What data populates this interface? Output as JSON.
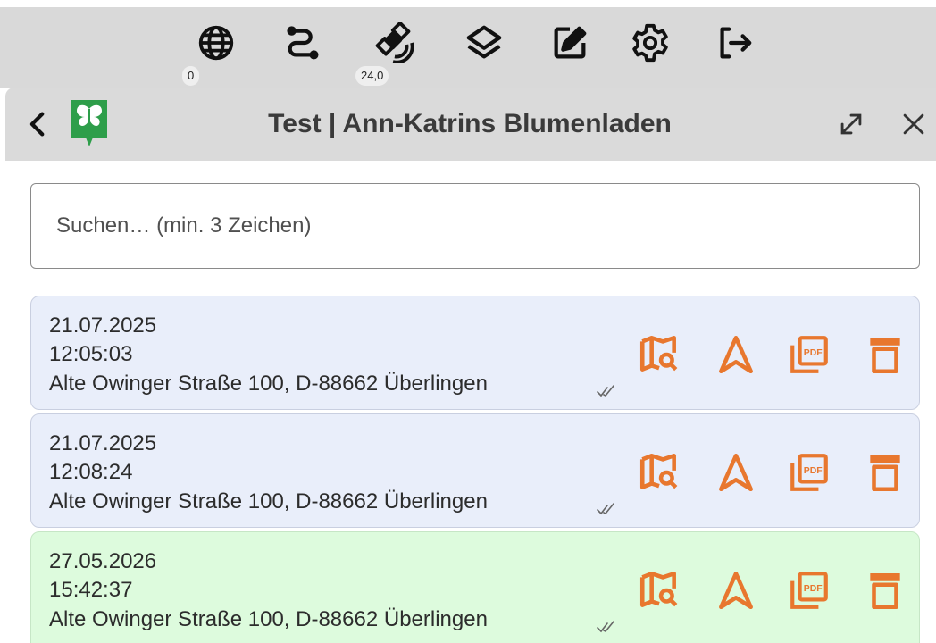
{
  "toolbar": {
    "items": [
      {
        "icon": "globe-icon",
        "badge": "0"
      },
      {
        "icon": "route-icon"
      },
      {
        "icon": "gps-satellite-icon",
        "badge": "24,0"
      },
      {
        "icon": "layers-icon"
      },
      {
        "icon": "edit-icon"
      },
      {
        "icon": "settings-gear-icon"
      },
      {
        "icon": "logout-icon"
      }
    ]
  },
  "panel": {
    "title": "Test | Ann-Katrins Blumenladen",
    "logo_icon": "butterfly-logo-icon"
  },
  "search": {
    "placeholder": "Suchen… (min. 3 Zeichen)",
    "value": ""
  },
  "entries": [
    {
      "date": "21.07.2025",
      "time": "12:05:03",
      "address": "Alte Owinger Straße 100, D-88662 Überlingen",
      "status": "synced"
    },
    {
      "date": "21.07.2025",
      "time": "12:08:24",
      "address": "Alte Owinger Straße 100, D-88662 Überlingen",
      "status": "synced"
    },
    {
      "date": "27.05.2026",
      "time": "15:42:37",
      "address": "Alte Owinger Straße 100, D-88662 Überlingen",
      "status": "synced"
    }
  ],
  "colors": {
    "accent_orange": "#e8772e",
    "entry_blue": "#e9eefa",
    "entry_green": "#ddfbdd",
    "header_gray": "#dadada",
    "logo_green": "#2e9e4a"
  }
}
